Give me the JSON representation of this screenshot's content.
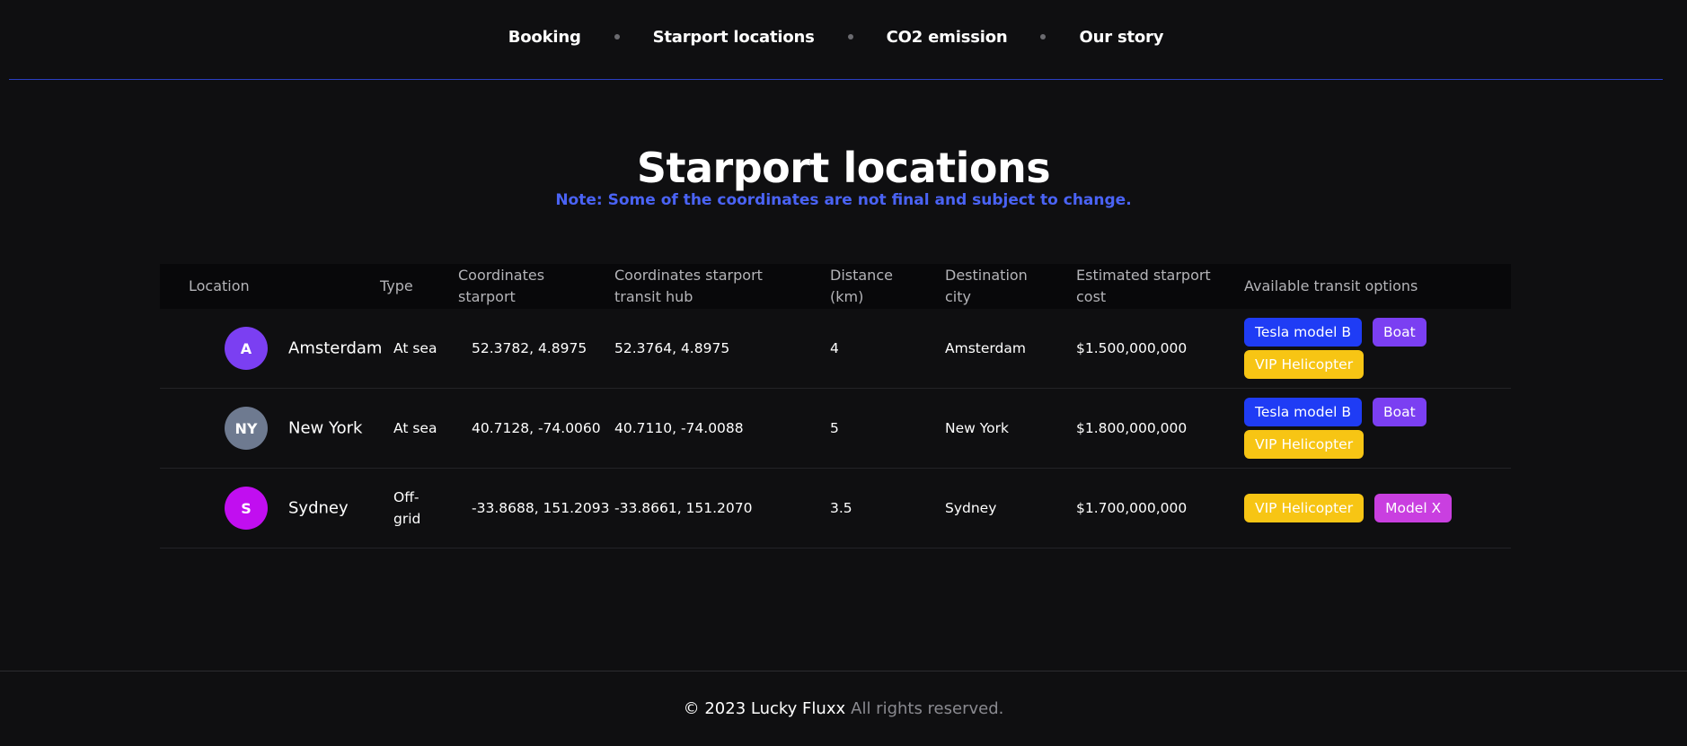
{
  "nav": {
    "items": [
      "Booking",
      "Starport locations",
      "CO2 emission",
      "Our story"
    ]
  },
  "header": {
    "title": "Starport locations",
    "note": "Note: Some of the coordinates are not final and subject to change."
  },
  "table": {
    "columns": [
      "Location",
      "Type",
      "Coordinates starport",
      "Coordinates starport transit hub",
      "Distance (km)",
      "Destination city",
      "Estimated starport cost",
      "Available transit options"
    ],
    "rows": [
      {
        "initials": "A",
        "avatar_color": "#7b3ff2",
        "location": "Amsterdam",
        "type": "At sea",
        "coords_starport": "52.3782, 4.8975",
        "coords_hub": "52.3764, 4.8975",
        "distance": "4",
        "city": "Amsterdam",
        "cost": "$1.500,000,000",
        "transit": [
          {
            "label": "Tesla model B",
            "color": "#1f3cf5"
          },
          {
            "label": "Boat",
            "color": "#7b3ff2"
          },
          {
            "label": "VIP Helicopter",
            "color": "#f7c514"
          }
        ]
      },
      {
        "initials": "NY",
        "avatar_color": "#6e7a90",
        "location": "New York",
        "type": "At sea",
        "coords_starport": "40.7128, -74.0060",
        "coords_hub": "40.7110, -74.0088",
        "distance": "5",
        "city": "New York",
        "cost": "$1.800,000,000",
        "transit": [
          {
            "label": "Tesla model B",
            "color": "#1f3cf5"
          },
          {
            "label": "Boat",
            "color": "#7b3ff2"
          },
          {
            "label": "VIP Helicopter",
            "color": "#f7c514"
          }
        ]
      },
      {
        "initials": "S",
        "avatar_color": "#c10ef0",
        "location": "Sydney",
        "type": "Off-grid",
        "coords_starport": "-33.8688, 151.2093",
        "coords_hub": "-33.8661, 151.2070",
        "distance": "3.5",
        "city": "Sydney",
        "cost": "$1.700,000,000",
        "transit": [
          {
            "label": "VIP Helicopter",
            "color": "#f7c514"
          },
          {
            "label": "Model X",
            "color": "#c93fe0"
          }
        ]
      }
    ]
  },
  "footer": {
    "copyright": "© 2023 Lucky Fluxx",
    "rights": "All rights reserved."
  }
}
